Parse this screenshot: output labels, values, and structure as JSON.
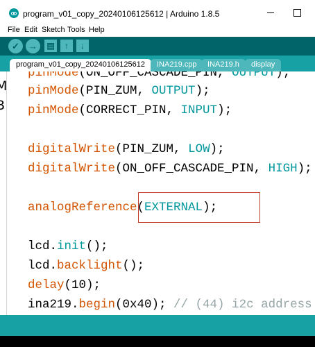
{
  "window": {
    "title": "program_v01_copy_20240106125612 | Arduino 1.8.5"
  },
  "menu": {
    "items": [
      "File",
      "Edit",
      "Sketch",
      "Tools",
      "Help"
    ]
  },
  "toolbar": {
    "verify_icon": "checkmark-icon",
    "upload_icon": "arrow-right-icon",
    "new_icon": "file-icon",
    "open_icon": "arrow-up-icon",
    "save_icon": "arrow-down-icon",
    "verify_glyph": "✓",
    "upload_glyph": "→",
    "new_glyph": "▤",
    "open_glyph": "↑",
    "save_glyph": "↓"
  },
  "tabs": [
    {
      "label": "program_v01_copy_20240106125612",
      "active": true
    },
    {
      "label": "INA219.cpp",
      "active": false
    },
    {
      "label": "INA219.h",
      "active": false
    },
    {
      "label": "display",
      "active": false
    }
  ],
  "left_pane": {
    "chars": [
      "M",
      "B"
    ]
  },
  "code": {
    "l1": {
      "fn": "pinMode",
      "open": "(",
      "arg": "ON_OFF_CASCADE_PIN",
      "sep": ", ",
      "const": "OUTPUT",
      "close": ");"
    },
    "l2": {
      "fn": "pinMode",
      "open": "(PIN_ZUM, ",
      "const": "OUTPUT",
      "close": ");"
    },
    "l3": {
      "fn": "pinMode",
      "open": "(CORRECT_PIN, ",
      "const": "INPUT",
      "close": ");"
    },
    "l4": {
      "fn": "digitalWrite",
      "open": "(PIN_ZUM, ",
      "const": "LOW",
      "close": ");"
    },
    "l5": {
      "fn": "digitalWrite",
      "open": "(ON_OFF_CASCADE_PIN, ",
      "const": "HIGH",
      "close": ");"
    },
    "l6": {
      "fn": "analogReference",
      "open": "(",
      "const": "EXTERNAL",
      "close": ");"
    },
    "l7": {
      "obj": "lcd.",
      "fn": "init",
      "close": "();"
    },
    "l8": {
      "obj": "lcd.",
      "fn": "backlight",
      "close": "();"
    },
    "l9": {
      "fn": "delay",
      "open": "(10);"
    },
    "l10": {
      "obj": "ina219.",
      "fn": "begin",
      "open": "(0x40);",
      "comment": " // (44) i2c address"
    }
  },
  "colors": {
    "toolbar_bg": "#006468",
    "tab_bar_bg": "#17a1a5",
    "keyword": "#d35400",
    "constant": "#00979c",
    "highlight_border": "#c0392b"
  }
}
